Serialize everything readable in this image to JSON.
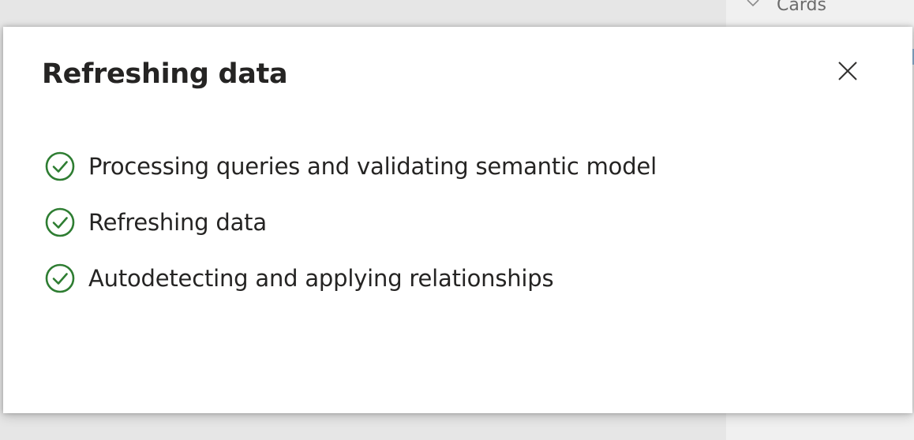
{
  "background": {
    "cards_label": "Cards"
  },
  "dialog": {
    "title": "Refreshing data",
    "close_icon": "close-icon",
    "steps": [
      {
        "label": "Processing queries and validating semantic model",
        "status": "complete",
        "icon": "check-circle-icon"
      },
      {
        "label": "Refreshing data",
        "status": "complete",
        "icon": "check-circle-icon"
      },
      {
        "label": "Autodetecting and applying relationships",
        "status": "complete",
        "icon": "check-circle-icon"
      }
    ]
  },
  "colors": {
    "success": "#2e7d32",
    "text": "#252423",
    "dialog_bg": "#ffffff",
    "backdrop": "#e6e6e6"
  }
}
